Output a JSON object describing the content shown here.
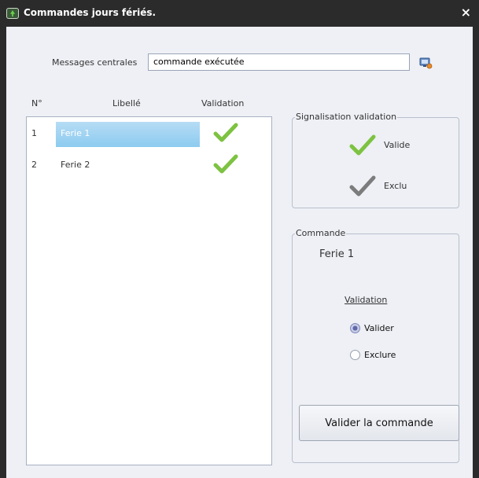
{
  "window": {
    "title": "Commandes jours fériés.",
    "close_glyph": "×"
  },
  "messages": {
    "label": "Messages centrales",
    "value": "commande exécutée"
  },
  "list": {
    "headers": {
      "num": "N°",
      "libelle": "Libellé",
      "validation": "Validation"
    },
    "rows": [
      {
        "num": "1",
        "label": "Ferie 1",
        "validated": true,
        "selected": true
      },
      {
        "num": "2",
        "label": "Ferie 2",
        "validated": true,
        "selected": false
      }
    ]
  },
  "signalisation": {
    "legend": "Signalisation validation",
    "valide_label": "Valide",
    "exclu_label": "Exclu"
  },
  "commande": {
    "legend": "Commande",
    "selected_name": "Ferie 1",
    "validation_title": "Validation",
    "options": [
      {
        "label": "Valider",
        "selected": true
      },
      {
        "label": "Exclure",
        "selected": false
      }
    ],
    "submit_label": "Valider la commande"
  },
  "colors": {
    "check_green": "#7dc241",
    "check_gray": "#7c7c7c",
    "selection_blue": "#9fd3f3"
  }
}
